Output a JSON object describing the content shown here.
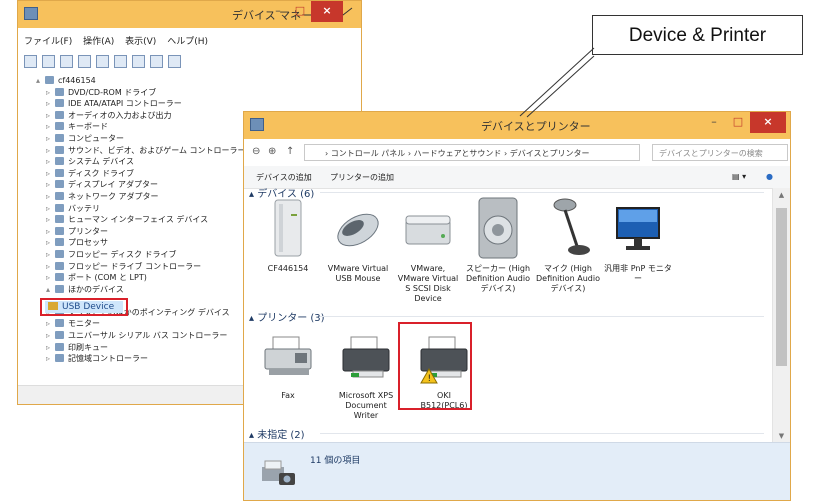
{
  "device_manager": {
    "title": "デバイス マネージャー",
    "menu": [
      "ファイル(F)",
      "操作(A)",
      "表示(V)",
      "ヘルプ(H)"
    ],
    "controls": {
      "minimize": "–",
      "maximize": "□",
      "close": "×"
    },
    "tree": [
      {
        "label": "cf446154",
        "icon": "computer-icon"
      },
      {
        "label": "DVD/CD-ROM ドライブ",
        "icon": "dvd-drive-icon"
      },
      {
        "label": "IDE ATA/ATAPI コントローラー",
        "icon": "ide-controller-icon"
      },
      {
        "label": "オーディオの入力および出力",
        "icon": "audio-icon"
      },
      {
        "label": "キーボード",
        "icon": "keyboard-icon"
      },
      {
        "label": "コンピューター",
        "icon": "computer-icon"
      },
      {
        "label": "サウンド、ビデオ、およびゲーム コントローラー",
        "icon": "sound-icon"
      },
      {
        "label": "システム デバイス",
        "icon": "system-device-icon"
      },
      {
        "label": "ディスク ドライブ",
        "icon": "disk-drive-icon"
      },
      {
        "label": "ディスプレイ アダプター",
        "icon": "display-adapter-icon"
      },
      {
        "label": "ネットワーク アダプター",
        "icon": "network-adapter-icon"
      },
      {
        "label": "バッテリ",
        "icon": "battery-icon"
      },
      {
        "label": "ヒューマン インターフェイス デバイス",
        "icon": "hid-icon"
      },
      {
        "label": "プリンター",
        "icon": "printer-icon"
      },
      {
        "label": "プロセッサ",
        "icon": "processor-icon"
      },
      {
        "label": "フロッピー ディスク ドライブ",
        "icon": "floppy-icon"
      },
      {
        "label": "フロッピー ドライブ コントローラー",
        "icon": "floppy-controller-icon"
      },
      {
        "label": "ポート (COM と LPT)",
        "icon": "port-icon"
      },
      {
        "label": "ほかのデバイス",
        "icon": "other-devices-icon"
      },
      {
        "label": "",
        "icon": "blank"
      },
      {
        "label": "マウスとそのほかのポインティング デバイス",
        "icon": "mouse-icon"
      },
      {
        "label": "モニター",
        "icon": "monitor-icon"
      },
      {
        "label": "ユニバーサル シリアル バス コントローラー",
        "icon": "usb-controller-icon"
      },
      {
        "label": "印刷キュー",
        "icon": "print-queue-icon"
      },
      {
        "label": "記憶域コントローラー",
        "icon": "storage-controller-icon"
      }
    ],
    "selected_device": "USB Device"
  },
  "devices_printers": {
    "title": "デバイスとプリンター",
    "controls": {
      "minimize": "–",
      "maximize": "□",
      "close": "×"
    },
    "nav": {
      "back": "⊖",
      "forward": "⊕",
      "up": "↑"
    },
    "address": "› コントロール パネル › ハードウェアとサウンド › デバイスとプリンター",
    "search_placeholder": "デバイスとプリンターの検索",
    "commands": {
      "add_device": "デバイスの追加",
      "add_printer": "プリンターの追加"
    },
    "groups": {
      "devices": "▴ デバイス (6)",
      "printers": "▴ プリンター (3)",
      "unspecified": "▴ 未指定 (2)"
    },
    "devices": [
      {
        "label": "CF446154",
        "icon": "computer-tower-icon"
      },
      {
        "label": "VMware Virtual\nUSB Mouse",
        "icon": "mouse-device-icon"
      },
      {
        "label": "VMware,\nVMware Virtual\nS SCSI Disk\nDevice",
        "icon": "disk-device-icon"
      },
      {
        "label": "スピーカー (High\nDefinition Audio\nデバイス)",
        "icon": "speaker-icon"
      },
      {
        "label": "マイク (High\nDefinition Audio\nデバイス)",
        "icon": "microphone-icon"
      },
      {
        "label": "汎用非 PnP モニタ\nー",
        "icon": "monitor-device-icon"
      }
    ],
    "printers": [
      {
        "label": "Fax",
        "icon": "fax-icon"
      },
      {
        "label": "Microsoft XPS\nDocument\nWriter",
        "icon": "printer-device-icon"
      },
      {
        "label": "OKI\nB512(PCL6)",
        "icon": "printer-warning-icon"
      }
    ],
    "status_count": "11 個の項目"
  },
  "callout": {
    "label": "Device & Printer"
  },
  "colors": {
    "titlebar": "#f7c15c",
    "close": "#c7372b",
    "highlight": "#d9202a"
  }
}
